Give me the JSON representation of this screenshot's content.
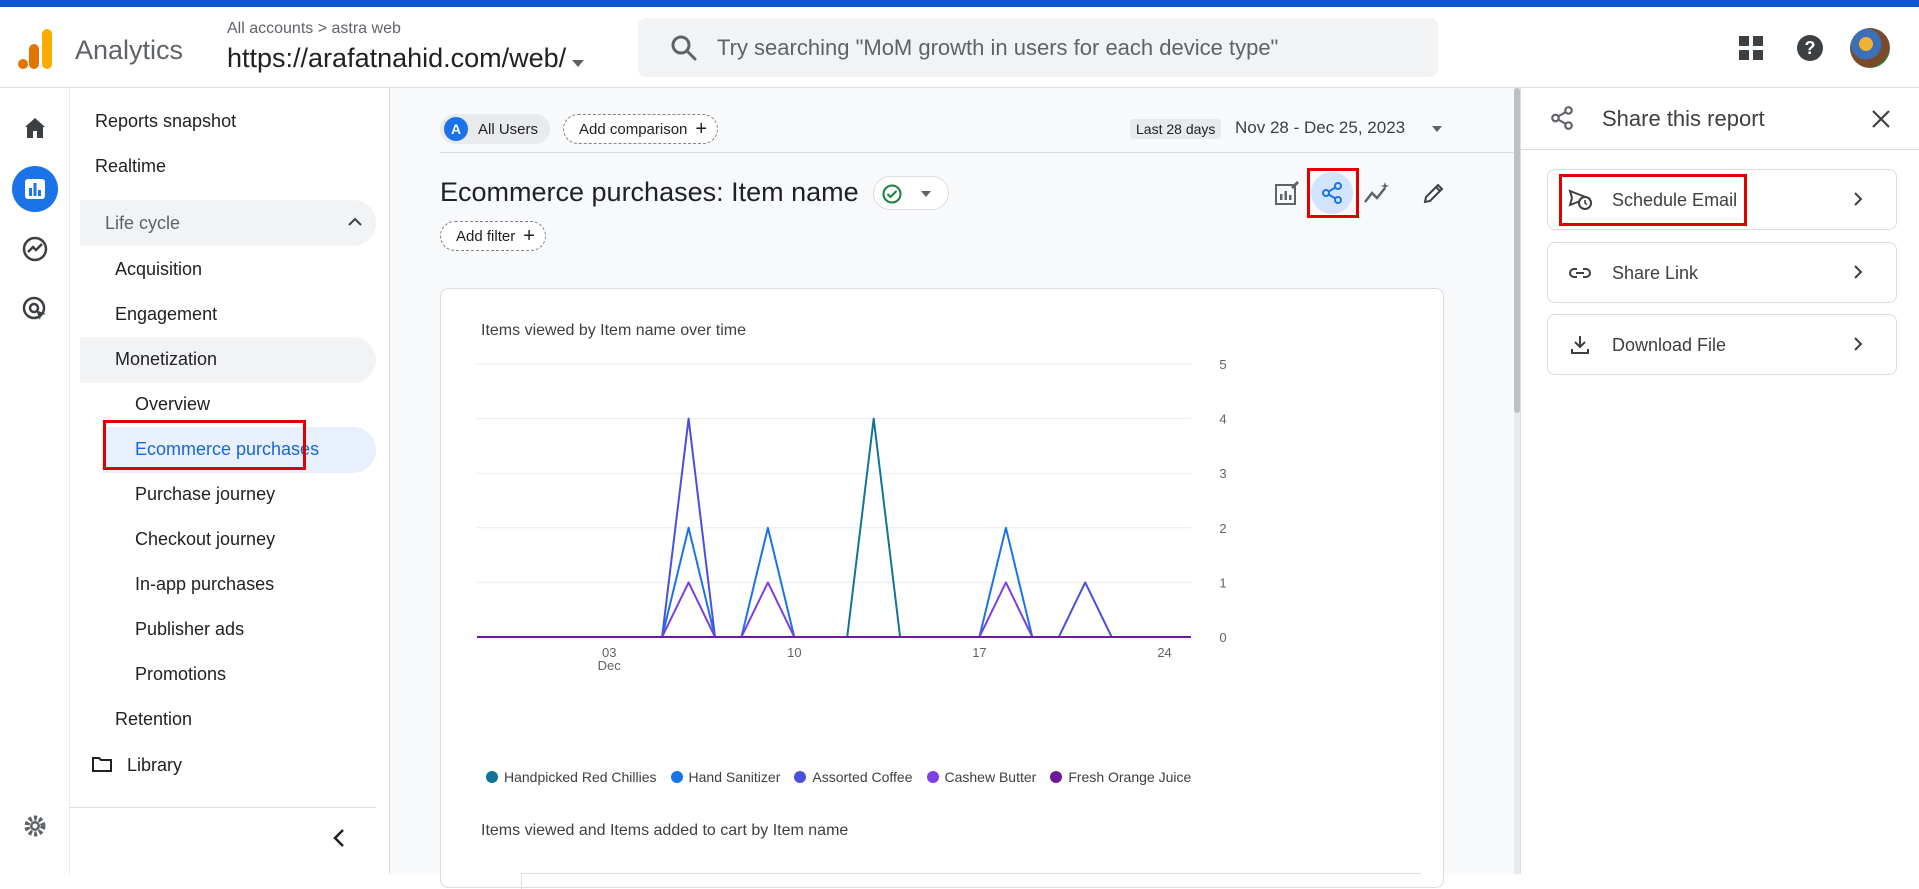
{
  "header": {
    "app_name": "Analytics",
    "breadcrumb": "All accounts > astra web",
    "property": "https://arafatnahid.com/web/",
    "search_placeholder": "Try searching \"MoM growth in users for each device type\""
  },
  "sidenav": {
    "top_items": [
      "Reports snapshot",
      "Realtime"
    ],
    "section": "Life cycle",
    "groups": [
      "Acquisition",
      "Engagement",
      "Monetization"
    ],
    "monetization_items": [
      "Overview",
      "Ecommerce purchases",
      "Purchase journey",
      "Checkout journey",
      "In-app purchases",
      "Publisher ads",
      "Promotions"
    ],
    "retention": "Retention",
    "library": "Library"
  },
  "main": {
    "users_chip_badge": "A",
    "users_chip": "All Users",
    "add_comparison": "Add comparison",
    "date_label": "Last 28 days",
    "date_range": "Nov 28 - Dec 25, 2023",
    "title": "Ecommerce purchases: Item name",
    "add_filter": "Add filter",
    "chart2_title": "Items viewed and Items added to cart by Item name"
  },
  "chart_data": {
    "type": "line",
    "title": "Items viewed by Item name over time",
    "x": [
      "Nov 28",
      "Nov 29",
      "Nov 30",
      "Dec 1",
      "Dec 2",
      "Dec 3",
      "Dec 4",
      "Dec 5",
      "Dec 6",
      "Dec 7",
      "Dec 8",
      "Dec 9",
      "Dec 10",
      "Dec 11",
      "Dec 12",
      "Dec 13",
      "Dec 14",
      "Dec 15",
      "Dec 16",
      "Dec 17",
      "Dec 18",
      "Dec 19",
      "Dec 20",
      "Dec 21",
      "Dec 22",
      "Dec 23",
      "Dec 24",
      "Dec 25"
    ],
    "x_tick_labels": [
      {
        "label": "03",
        "sublabel": "Dec",
        "index": 5
      },
      {
        "label": "10",
        "index": 12
      },
      {
        "label": "17",
        "index": 19
      },
      {
        "label": "24",
        "index": 26
      }
    ],
    "ylim": [
      0,
      5
    ],
    "yticks": [
      "0",
      "1",
      "2",
      "3",
      "4",
      "5"
    ],
    "y_axis_side": "right",
    "grid": true,
    "legend_position": "bottom",
    "series": [
      {
        "name": "Handpicked Red Chillies",
        "color": "#12739b",
        "values": [
          0,
          0,
          0,
          0,
          0,
          0,
          0,
          0,
          0,
          0,
          0,
          0,
          0,
          0,
          0,
          4,
          0,
          0,
          0,
          0,
          0,
          0,
          0,
          0,
          0,
          0,
          0,
          0
        ]
      },
      {
        "name": "Hand Sanitizer",
        "color": "#1a73e8",
        "values": [
          0,
          0,
          0,
          0,
          0,
          0,
          0,
          0,
          2,
          0,
          0,
          2,
          0,
          0,
          0,
          0,
          0,
          0,
          0,
          0,
          2,
          0,
          0,
          0,
          0,
          0,
          0,
          0
        ]
      },
      {
        "name": "Assorted Coffee",
        "color": "#4a4fe0",
        "values": [
          0,
          0,
          0,
          0,
          0,
          0,
          0,
          0,
          4,
          0,
          0,
          0,
          0,
          0,
          0,
          0,
          0,
          0,
          0,
          0,
          0,
          0,
          0,
          1,
          0,
          0,
          0,
          0
        ]
      },
      {
        "name": "Cashew Butter",
        "color": "#7b3fe4",
        "values": [
          0,
          0,
          0,
          0,
          0,
          0,
          0,
          0,
          1,
          0,
          0,
          1,
          0,
          0,
          0,
          0,
          0,
          0,
          0,
          0,
          1,
          0,
          0,
          0,
          0,
          0,
          0,
          0
        ]
      },
      {
        "name": "Fresh Orange Juice",
        "color": "#6a1b9a",
        "values": [
          0,
          0,
          0,
          0,
          0,
          0,
          0,
          0,
          0,
          0,
          0,
          0,
          0,
          0,
          0,
          0,
          0,
          0,
          0,
          0,
          0,
          0,
          0,
          0,
          0,
          0,
          0,
          0
        ]
      }
    ]
  },
  "panel": {
    "title": "Share this report",
    "options": [
      "Schedule Email",
      "Share Link",
      "Download File"
    ]
  }
}
